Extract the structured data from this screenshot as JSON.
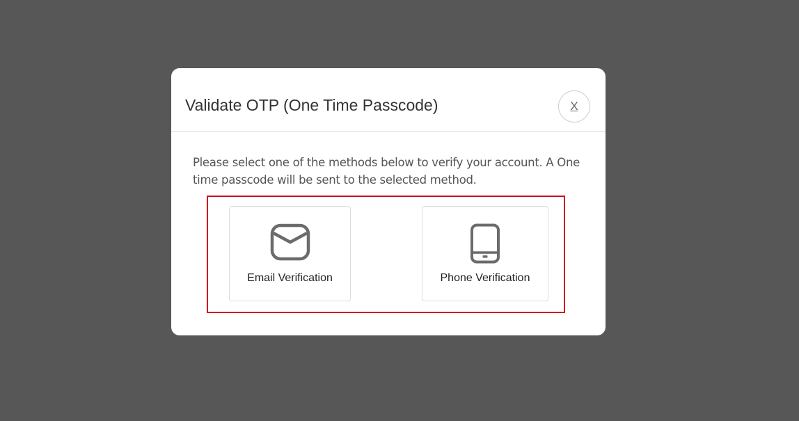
{
  "modal": {
    "title": "Validate OTP (One Time Passcode)",
    "close_label": "X",
    "instructions": "Please select one of the methods below to verify your account. A One time passcode will be sent to the selected method.",
    "methods": [
      {
        "label": "Email Verification",
        "icon": "envelope-icon"
      },
      {
        "label": "Phone Verification",
        "icon": "mobile-phone-icon"
      }
    ]
  },
  "colors": {
    "overlay": "#575757",
    "highlight_border": "#d0021b",
    "icon": "#6b6b6b"
  }
}
